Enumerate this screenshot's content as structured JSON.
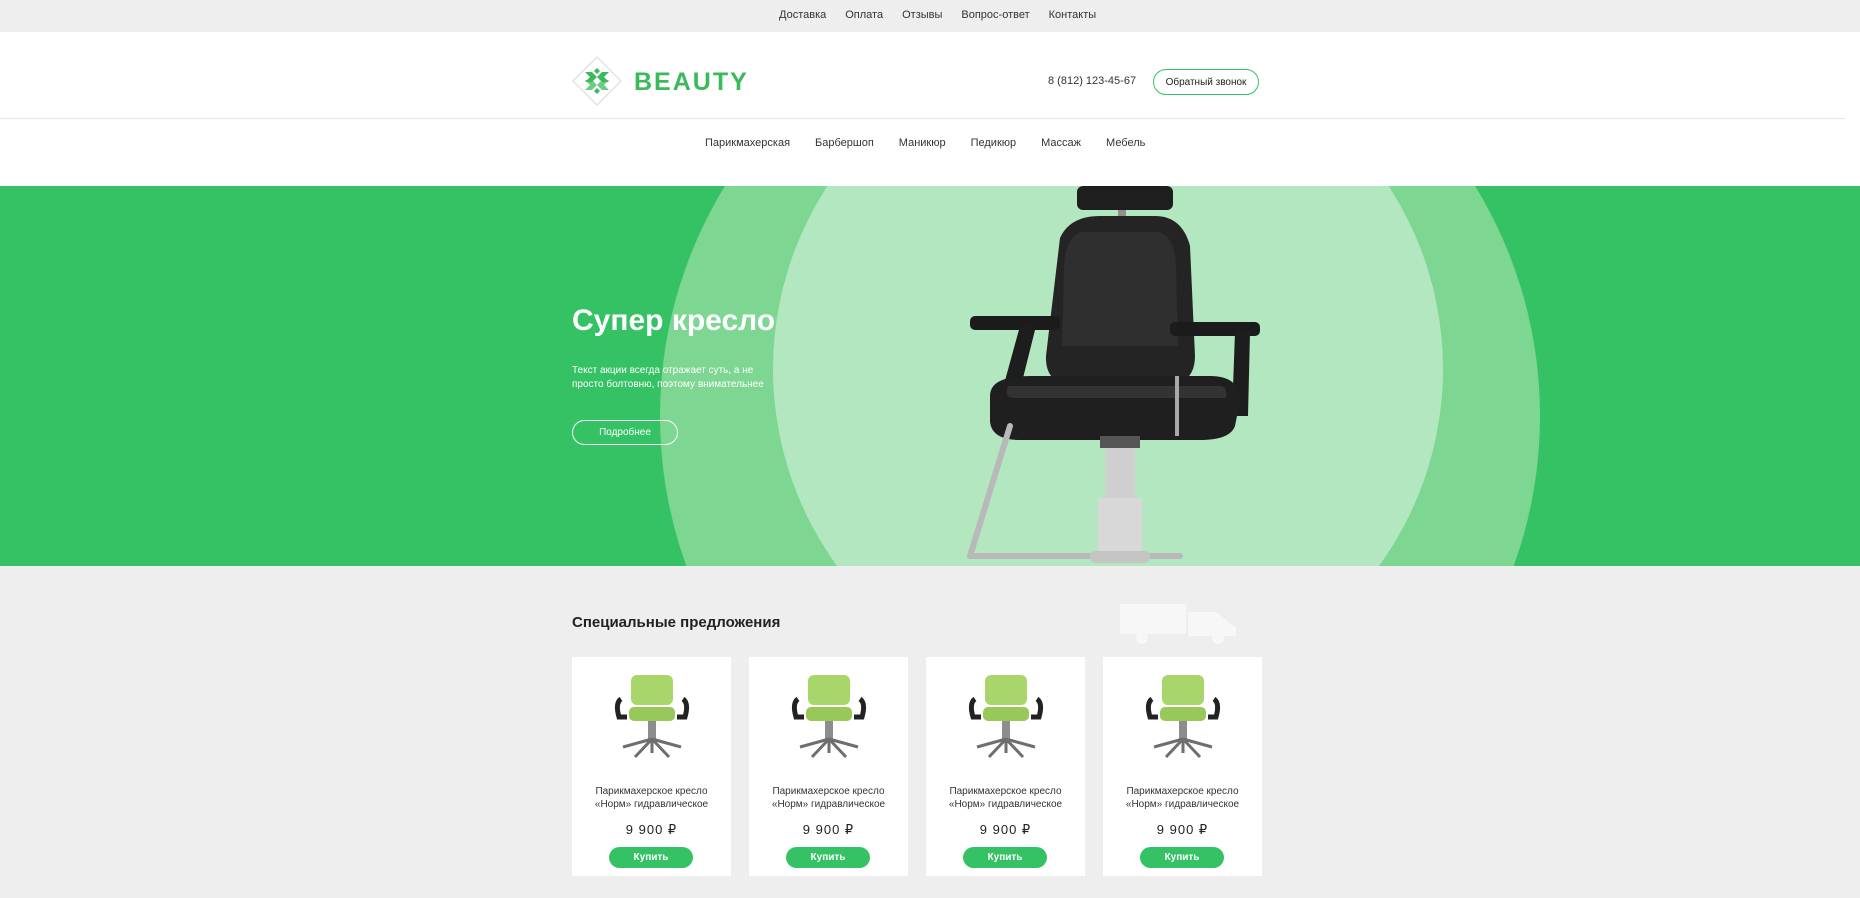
{
  "topbar": {
    "links": [
      "Доставка",
      "Оплата",
      "Отзывы",
      "Вопрос-ответ",
      "Контакты"
    ]
  },
  "header": {
    "brand": "BEAUTY",
    "phone": "8 (812) 123-45-67",
    "callback_label": "Обратный звонок"
  },
  "catnav": {
    "items": [
      "Парикмахерская",
      "Барбершоп",
      "Маникюр",
      "Педикюр",
      "Массаж",
      "Мебель"
    ]
  },
  "hero": {
    "title": "Супер кресло",
    "text": "Текст акции всегда отражает суть, а не просто болтовню, поэтому внимательнее",
    "button_label": "Подробнее"
  },
  "offers": {
    "title": "Специальные предложения",
    "cards": [
      {
        "name": "Парикмахерское кресло «Норм» гидравлическое",
        "price": "9 900 ₽",
        "buy_label": "Купить"
      },
      {
        "name": "Парикмахерское кресло «Норм» гидравлическое",
        "price": "9 900 ₽",
        "buy_label": "Купить"
      },
      {
        "name": "Парикмахерское кресло «Норм» гидравлическое",
        "price": "9 900 ₽",
        "buy_label": "Купить"
      },
      {
        "name": "Парикмахерское кресло «Норм» гидравлическое",
        "price": "9 900 ₽",
        "buy_label": "Купить"
      }
    ]
  },
  "colors": {
    "accent": "#35c265",
    "brand": "#3cb95b",
    "hero_ring_outer": "#7dd691",
    "hero_ring_inner": "#b2e7c0",
    "page_bg": "#eeeeee"
  },
  "icons": [
    "logo-icon",
    "chair-image",
    "truck-icon",
    "product-chair-image"
  ]
}
